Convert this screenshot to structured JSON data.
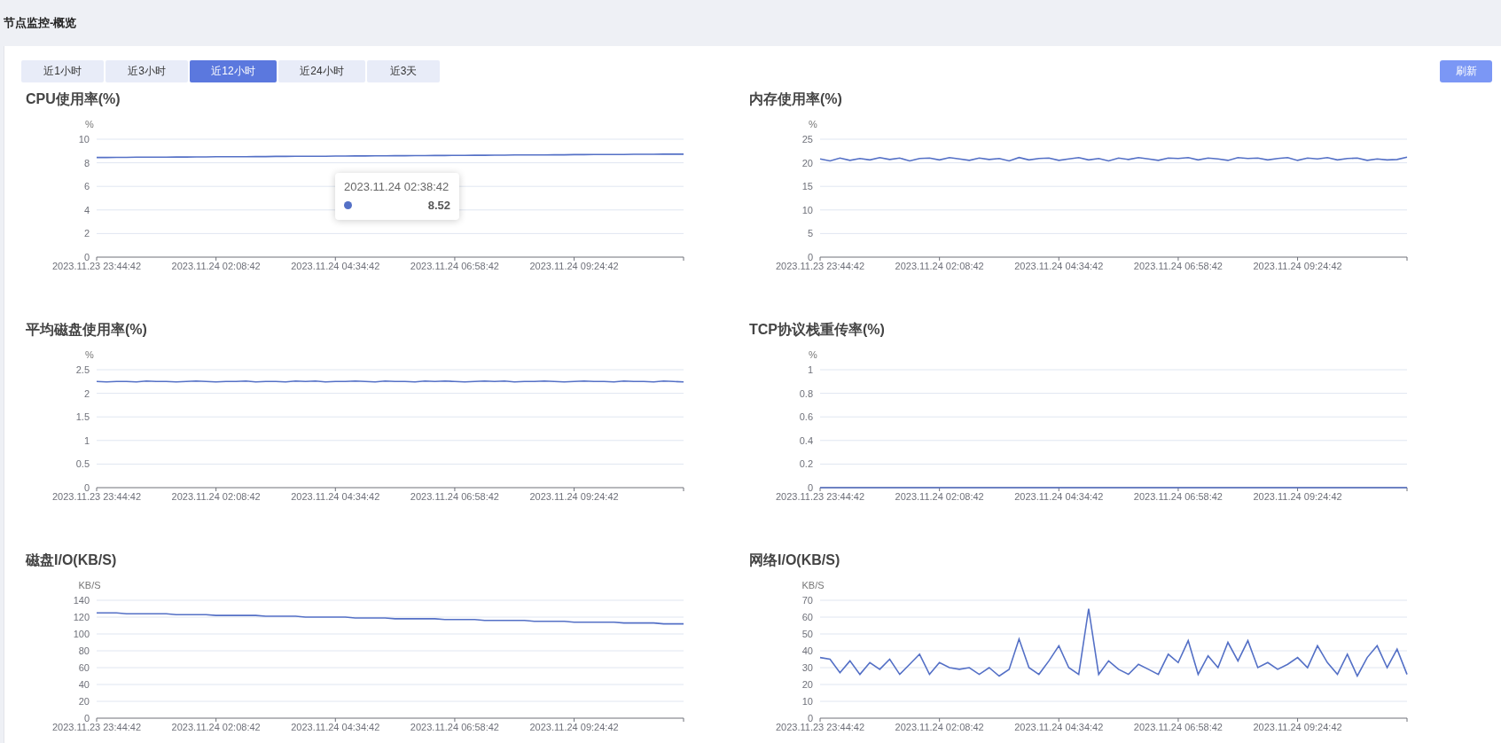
{
  "header": {
    "title": "节点监控-概览"
  },
  "tabs": [
    {
      "label": "近1小时",
      "selected": false
    },
    {
      "label": "近3小时",
      "selected": false
    },
    {
      "label": "近12小时",
      "selected": true
    },
    {
      "label": "近24小时",
      "selected": false
    },
    {
      "label": "近3天",
      "selected": false
    }
  ],
  "refresh_button": {
    "label": "刷新"
  },
  "charts": [
    {
      "chart_data": {
        "type": "line",
        "title": "CPU使用率(%)",
        "ylabel": "%",
        "grid": true,
        "ylim": [
          0,
          10
        ],
        "yticks": [
          0,
          2,
          4,
          6,
          8,
          10
        ],
        "categories": [
          "2023.11.23 23:44:42",
          null,
          null,
          null,
          null,
          null,
          null,
          null,
          null,
          null,
          null,
          null,
          "2023.11.24 02:08:42",
          null,
          null,
          null,
          null,
          null,
          null,
          null,
          null,
          null,
          null,
          null,
          "2023.11.24 04:34:42",
          null,
          null,
          null,
          null,
          null,
          null,
          null,
          null,
          null,
          null,
          null,
          "2023.11.24 06:58:42",
          null,
          null,
          null,
          null,
          null,
          null,
          null,
          null,
          null,
          null,
          null,
          "2023.11.24 09:24:42",
          null,
          null,
          null,
          null,
          null,
          null,
          null,
          null,
          null,
          null,
          null
        ],
        "series": [
          {
            "color": "#5470c6",
            "values": [
              8.45,
              8.45,
              8.46,
              8.46,
              8.47,
              8.47,
              8.48,
              8.48,
              8.49,
              8.49,
              8.5,
              8.5,
              8.51,
              8.51,
              8.52,
              8.52,
              8.53,
              8.53,
              8.54,
              8.54,
              8.55,
              8.55,
              8.56,
              8.56,
              8.57,
              8.57,
              8.58,
              8.58,
              8.59,
              8.59,
              8.6,
              8.6,
              8.61,
              8.61,
              8.62,
              8.62,
              8.63,
              8.63,
              8.64,
              8.64,
              8.65,
              8.65,
              8.66,
              8.66,
              8.67,
              8.67,
              8.68,
              8.68,
              8.69,
              8.69,
              8.7,
              8.7,
              8.71,
              8.71,
              8.72,
              8.72,
              8.72,
              8.73,
              8.73,
              8.73
            ]
          }
        ]
      },
      "tooltip": {
        "title": "2023.11.24 02:38:42",
        "value": "8.52"
      }
    },
    {
      "chart_data": {
        "type": "line",
        "title": "内存使用率(%)",
        "ylabel": "%",
        "grid": true,
        "ylim": [
          0,
          25
        ],
        "yticks": [
          0,
          5,
          10,
          15,
          20,
          25
        ],
        "categories": [
          "2023.11.23 23:44:42",
          null,
          null,
          null,
          null,
          null,
          null,
          null,
          null,
          null,
          null,
          null,
          "2023.11.24 02:08:42",
          null,
          null,
          null,
          null,
          null,
          null,
          null,
          null,
          null,
          null,
          null,
          "2023.11.24 04:34:42",
          null,
          null,
          null,
          null,
          null,
          null,
          null,
          null,
          null,
          null,
          null,
          "2023.11.24 06:58:42",
          null,
          null,
          null,
          null,
          null,
          null,
          null,
          null,
          null,
          null,
          null,
          "2023.11.24 09:24:42",
          null,
          null,
          null,
          null,
          null,
          null,
          null,
          null,
          null,
          null,
          null
        ],
        "series": [
          {
            "color": "#5470c6",
            "values": [
              20.8,
              20.4,
              21.0,
              20.5,
              20.9,
              20.6,
              21.1,
              20.7,
              21.0,
              20.4,
              20.9,
              21.0,
              20.6,
              21.1,
              20.8,
              20.5,
              21.0,
              20.7,
              20.9,
              20.4,
              21.1,
              20.6,
              20.9,
              21.0,
              20.5,
              20.8,
              21.1,
              20.6,
              20.9,
              20.4,
              21.0,
              20.7,
              21.1,
              20.8,
              20.5,
              21.0,
              20.9,
              21.1,
              20.6,
              21.0,
              20.8,
              20.5,
              21.1,
              20.9,
              21.0,
              20.6,
              20.9,
              21.1,
              20.5,
              21.0,
              20.8,
              21.1,
              20.6,
              20.9,
              21.0,
              20.5,
              20.8,
              20.6,
              20.7,
              21.2
            ]
          }
        ]
      }
    },
    {
      "chart_data": {
        "type": "line",
        "title": "平均磁盘使用率(%)",
        "ylabel": "%",
        "grid": true,
        "ylim": [
          0,
          2.5
        ],
        "yticks": [
          0,
          0.5,
          1,
          1.5,
          2,
          2.5
        ],
        "categories": [
          "2023.11.23 23:44:42",
          null,
          null,
          null,
          null,
          null,
          null,
          null,
          null,
          null,
          null,
          null,
          "2023.11.24 02:08:42",
          null,
          null,
          null,
          null,
          null,
          null,
          null,
          null,
          null,
          null,
          null,
          "2023.11.24 04:34:42",
          null,
          null,
          null,
          null,
          null,
          null,
          null,
          null,
          null,
          null,
          null,
          "2023.11.24 06:58:42",
          null,
          null,
          null,
          null,
          null,
          null,
          null,
          null,
          null,
          null,
          null,
          "2023.11.24 09:24:42",
          null,
          null,
          null,
          null,
          null,
          null,
          null,
          null,
          null,
          null,
          null
        ],
        "series": [
          {
            "color": "#5470c6",
            "values": [
              2.25,
              2.24,
              2.25,
              2.25,
              2.24,
              2.26,
              2.25,
              2.25,
              2.24,
              2.25,
              2.26,
              2.25,
              2.24,
              2.25,
              2.25,
              2.26,
              2.24,
              2.25,
              2.25,
              2.24,
              2.26,
              2.25,
              2.26,
              2.24,
              2.25,
              2.25,
              2.26,
              2.25,
              2.24,
              2.26,
              2.25,
              2.25,
              2.24,
              2.26,
              2.25,
              2.26,
              2.25,
              2.24,
              2.25,
              2.26,
              2.25,
              2.26,
              2.24,
              2.25,
              2.25,
              2.26,
              2.25,
              2.24,
              2.25,
              2.26,
              2.25,
              2.25,
              2.24,
              2.26,
              2.25,
              2.25,
              2.24,
              2.26,
              2.25,
              2.24
            ]
          }
        ]
      }
    },
    {
      "chart_data": {
        "type": "line",
        "title": "TCP协议栈重传率(%)",
        "ylabel": "%",
        "grid": true,
        "ylim": [
          0,
          1
        ],
        "yticks": [
          0,
          0.2,
          0.4,
          0.6,
          0.8,
          1
        ],
        "categories": [
          "2023.11.23 23:44:42",
          null,
          null,
          null,
          null,
          null,
          null,
          null,
          null,
          null,
          null,
          null,
          "2023.11.24 02:08:42",
          null,
          null,
          null,
          null,
          null,
          null,
          null,
          null,
          null,
          null,
          null,
          "2023.11.24 04:34:42",
          null,
          null,
          null,
          null,
          null,
          null,
          null,
          null,
          null,
          null,
          null,
          "2023.11.24 06:58:42",
          null,
          null,
          null,
          null,
          null,
          null,
          null,
          null,
          null,
          null,
          null,
          "2023.11.24 09:24:42",
          null,
          null,
          null,
          null,
          null,
          null,
          null,
          null,
          null,
          null,
          null
        ],
        "series": [
          {
            "color": "#5470c6",
            "values": [
              0,
              0,
              0,
              0,
              0,
              0,
              0,
              0,
              0,
              0,
              0,
              0,
              0,
              0,
              0,
              0,
              0,
              0,
              0,
              0,
              0,
              0,
              0,
              0,
              0,
              0,
              0,
              0,
              0,
              0,
              0,
              0,
              0,
              0,
              0,
              0,
              0,
              0,
              0,
              0,
              0,
              0,
              0,
              0,
              0,
              0,
              0,
              0,
              0,
              0,
              0,
              0,
              0,
              0,
              0,
              0,
              0,
              0,
              0,
              0
            ]
          }
        ]
      }
    },
    {
      "chart_data": {
        "type": "line",
        "title": "磁盘I/O(KB/S)",
        "ylabel": "KB/S",
        "grid": true,
        "ylim": [
          0,
          140
        ],
        "yticks": [
          0,
          20,
          40,
          60,
          80,
          100,
          120,
          140
        ],
        "categories": [
          "2023.11.23 23:44:42",
          null,
          null,
          null,
          null,
          null,
          null,
          null,
          null,
          null,
          null,
          null,
          "2023.11.24 02:08:42",
          null,
          null,
          null,
          null,
          null,
          null,
          null,
          null,
          null,
          null,
          null,
          "2023.11.24 04:34:42",
          null,
          null,
          null,
          null,
          null,
          null,
          null,
          null,
          null,
          null,
          null,
          "2023.11.24 06:58:42",
          null,
          null,
          null,
          null,
          null,
          null,
          null,
          null,
          null,
          null,
          null,
          "2023.11.24 09:24:42",
          null,
          null,
          null,
          null,
          null,
          null,
          null,
          null,
          null,
          null,
          null
        ],
        "series": [
          {
            "color": "#5470c6",
            "values": [
              125,
              125,
              125,
              124,
              124,
              124,
              124,
              124,
              123,
              123,
              123,
              123,
              122,
              122,
              122,
              122,
              122,
              121,
              121,
              121,
              121,
              120,
              120,
              120,
              120,
              120,
              119,
              119,
              119,
              119,
              118,
              118,
              118,
              118,
              118,
              117,
              117,
              117,
              117,
              116,
              116,
              116,
              116,
              116,
              115,
              115,
              115,
              115,
              114,
              114,
              114,
              114,
              114,
              113,
              113,
              113,
              113,
              112,
              112,
              112
            ]
          }
        ]
      }
    },
    {
      "chart_data": {
        "type": "line",
        "title": "网络I/O(KB/S)",
        "ylabel": "KB/S",
        "grid": true,
        "ylim": [
          0,
          70
        ],
        "yticks": [
          0,
          10,
          20,
          30,
          40,
          50,
          60,
          70
        ],
        "categories": [
          "2023.11.23 23:44:42",
          null,
          null,
          null,
          null,
          null,
          null,
          null,
          null,
          null,
          null,
          null,
          "2023.11.24 02:08:42",
          null,
          null,
          null,
          null,
          null,
          null,
          null,
          null,
          null,
          null,
          null,
          "2023.11.24 04:34:42",
          null,
          null,
          null,
          null,
          null,
          null,
          null,
          null,
          null,
          null,
          null,
          "2023.11.24 06:58:42",
          null,
          null,
          null,
          null,
          null,
          null,
          null,
          null,
          null,
          null,
          null,
          "2023.11.24 09:24:42",
          null,
          null,
          null,
          null,
          null,
          null,
          null,
          null,
          null,
          null,
          null
        ],
        "series": [
          {
            "color": "#5470c6",
            "values": [
              36,
              35,
              27,
              34,
              26,
              33,
              29,
              35,
              26,
              32,
              38,
              26,
              33,
              30,
              29,
              30,
              26,
              30,
              25,
              29,
              47,
              30,
              26,
              34,
              43,
              30,
              26,
              65,
              26,
              34,
              29,
              26,
              32,
              29,
              26,
              38,
              33,
              46,
              26,
              37,
              30,
              45,
              34,
              46,
              30,
              33,
              29,
              32,
              36,
              30,
              43,
              33,
              26,
              38,
              25,
              36,
              43,
              30,
              41,
              26
            ]
          }
        ]
      }
    }
  ]
}
